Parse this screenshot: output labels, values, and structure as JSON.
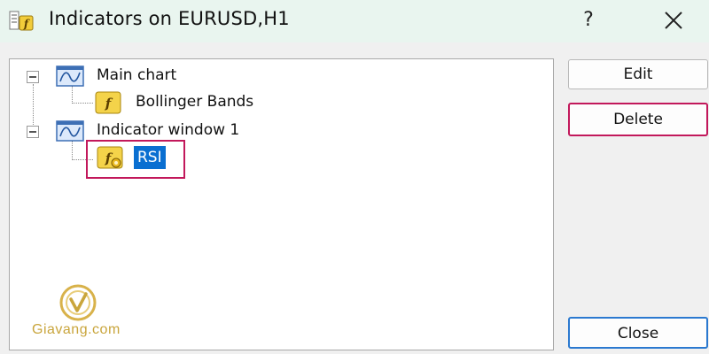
{
  "window": {
    "title": "Indicators on EURUSD,H1",
    "help_label": "?",
    "title_icon": "indicators-list-icon",
    "close_icon": "close-icon"
  },
  "tree": {
    "nodes": [
      {
        "label": "Main chart",
        "icon": "chart-window-icon",
        "expanded": true,
        "children": [
          {
            "label": "Bollinger Bands",
            "icon": "indicator-f-icon"
          }
        ]
      },
      {
        "label": "Indicator window 1",
        "icon": "chart-window-icon",
        "expanded": true,
        "children": [
          {
            "label": "RSI",
            "icon": "custom-indicator-f-icon",
            "selected": true
          }
        ]
      }
    ]
  },
  "buttons": {
    "edit": "Edit",
    "delete": "Delete",
    "close": "Close"
  },
  "colors": {
    "selection": "#0a6fd1",
    "highlight": "#c2185b",
    "titlebar": "#e9f5ef",
    "watermark": "#c9a53c"
  },
  "watermark": {
    "text": "Giavang.com",
    "logo": "giavang-logo"
  }
}
